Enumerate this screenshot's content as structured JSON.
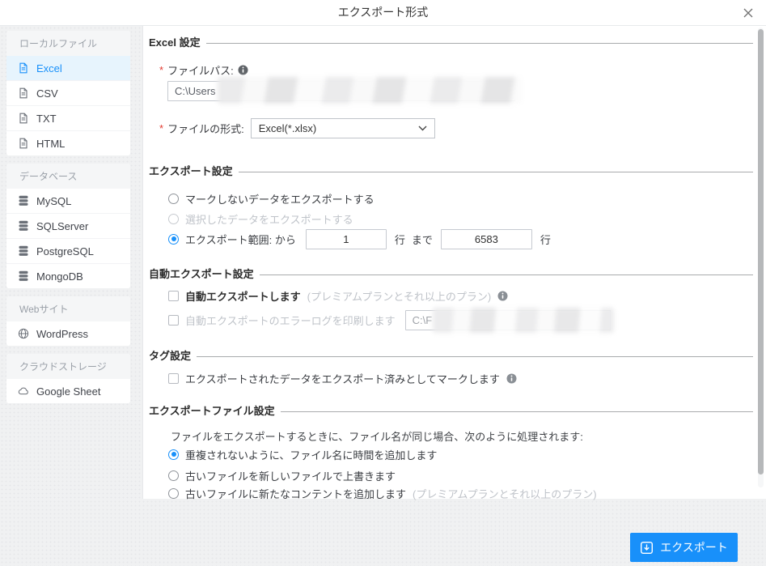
{
  "colors": {
    "accent": "#1890fa",
    "selected_bg": "#e7f4fd"
  },
  "dialog": {
    "title": "エクスポート形式",
    "required_mark": "*"
  },
  "sidebar": {
    "groups": [
      {
        "header": "ローカルファイル",
        "items": [
          {
            "label": "Excel"
          },
          {
            "label": "CSV"
          },
          {
            "label": "TXT"
          },
          {
            "label": "HTML"
          }
        ]
      },
      {
        "header": "データベース",
        "items": [
          {
            "label": "MySQL"
          },
          {
            "label": "SQLServer"
          },
          {
            "label": "PostgreSQL"
          },
          {
            "label": "MongoDB"
          }
        ]
      },
      {
        "header": "Webサイト",
        "items": [
          {
            "label": "WordPress"
          }
        ]
      },
      {
        "header": "クラウドストレージ",
        "items": [
          {
            "label": "Google Sheet"
          }
        ]
      }
    ]
  },
  "excel_settings": {
    "title": "Excel 設定",
    "file_path_label": "ファイルパス:",
    "file_path_value": "C:\\Users",
    "file_format_label": "ファイルの形式:",
    "file_format_value": "Excel(*.xlsx)"
  },
  "export_settings": {
    "title": "エクスポート設定",
    "option_unmarked": "マークしないデータをエクスポートする",
    "option_selected": "選択したデータをエクスポートする",
    "option_range": "エクスポート範囲: から",
    "range_from": "1",
    "unit_row1": "行",
    "unit_to": "まで",
    "range_to": "6583",
    "unit_row2": "行"
  },
  "auto_export_settings": {
    "title": "自動エクスポート設定",
    "auto_export_label": "自動エクスポートします",
    "auto_export_note": "(プレミアムプランとそれ以上のプラン)",
    "error_log_label": "自動エクスポートのエラーログを印刷します",
    "error_log_path": "C:\\F"
  },
  "tag_settings": {
    "title": "タグ設定",
    "mark_exported_label": "エクスポートされたデータをエクスポート済みとしてマークします"
  },
  "export_file_settings": {
    "title": "エクスポートファイル設定",
    "description": "ファイルをエクスポートするときに、ファイル名が同じ場合、次のように処理されます:",
    "option_add_time": "重複されないように、ファイル名に時間を追加します",
    "option_overwrite": "古いファイルを新しいファイルで上書きます",
    "option_append": "古いファイルに新たなコンテントを追加します",
    "option_append_note": "(プレミアムプランとそれ以上のプラン)"
  },
  "footer": {
    "export_button_label": "エクスポート"
  }
}
